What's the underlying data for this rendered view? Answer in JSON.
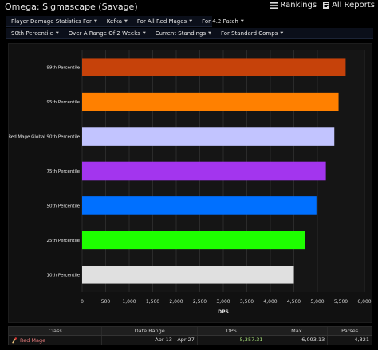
{
  "page": {
    "title": "Omega: Sigmascape (Savage)",
    "rankings_label": "Rankings",
    "all_reports_label": "All Reports"
  },
  "filters_row1": [
    {
      "label": "Player Damage Statistics For"
    },
    {
      "label": "Kefka"
    },
    {
      "label": "For All Red Mages"
    },
    {
      "label": "For 4.2 Patch"
    }
  ],
  "filters_row2": [
    {
      "label": "90th Percentile"
    },
    {
      "label": "Over A Range Of 2 Weeks"
    },
    {
      "label": "Current Standings"
    },
    {
      "label": "For Standard Comps"
    }
  ],
  "chart_data": {
    "type": "bar",
    "orientation": "horizontal",
    "title": "",
    "xlabel": "DPS",
    "ylabel": "",
    "xlim": [
      0,
      6000
    ],
    "xticks": [
      0,
      500,
      1000,
      1500,
      2000,
      2500,
      3000,
      3500,
      4000,
      4500,
      5000,
      5500,
      6000
    ],
    "xtick_labels": [
      "0",
      "500",
      "1,000",
      "1,500",
      "2,000",
      "2,500",
      "3,000",
      "3,500",
      "4,000",
      "4,500",
      "5,000",
      "5,500",
      "6,000"
    ],
    "grid": true,
    "categories": [
      "99th Percentile",
      "95th Percentile",
      "Red Mage Global 90th Percentile",
      "75th Percentile",
      "50th Percentile",
      "25th Percentile",
      "10th Percentile"
    ],
    "values": [
      5600,
      5450,
      5360,
      5180,
      4980,
      4740,
      4500
    ],
    "colors": [
      "#c6420a",
      "#ff8000",
      "#c2c4ff",
      "#a335ee",
      "#0070ff",
      "#1eff00",
      "#e0e0e0"
    ]
  },
  "table": {
    "headers": [
      "Class",
      "Date Range",
      "DPS",
      "Max",
      "Parses"
    ],
    "rows": [
      {
        "class": "Red Mage",
        "date_range": "Apr 13 - Apr 27",
        "dps": "5,357.31",
        "max": "6,093.13",
        "parses": "4,321"
      }
    ],
    "class_color": "#e57b7b",
    "dps_color": "#a8e07a"
  }
}
